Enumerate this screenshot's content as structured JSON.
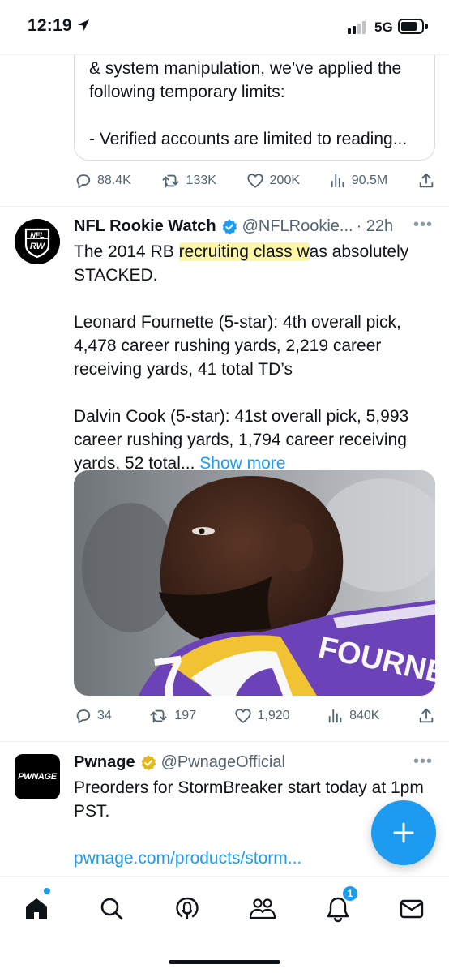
{
  "status_bar": {
    "time": "12:19",
    "network": "5G"
  },
  "quote_card": {
    "lines": [
      "& system manipulation, we’ve applied the",
      "following temporary limits:",
      "- Verified accounts are limited to reading..."
    ]
  },
  "tweet1_actions": {
    "replies": "88.4K",
    "retweets": "133K",
    "likes": "200K",
    "views": "90.5M"
  },
  "tweet2": {
    "name": "NFL Rookie Watch",
    "handle": "@NFLRookie...",
    "time": "· 22h",
    "avatar_text_top": "NFL",
    "avatar_text_bottom": "RW",
    "text_pre": "The 2014 RB ",
    "text_highlight": "recruiting class w",
    "text_post": "as absolutely",
    "text_line2": "STACKED.",
    "para2": "Leonard Fournette (5-star): 4th overall pick, 4,478 career rushing yards, 2,219 career receiving yards, 41 total TD’s",
    "para3": "Dalvin Cook (5-star): 41st overall pick, 5,993 career rushing yards, 1,794 career receiving yards, 52 total...",
    "show_more": "Show more",
    "media_jersey_number": "7",
    "media_jersey_name": "FOURNE",
    "actions": {
      "replies": "34",
      "retweets": "197",
      "likes": "1,920",
      "views": "840K"
    }
  },
  "tweet3": {
    "name": "Pwnage",
    "handle": "@PwnageOfficial",
    "avatar_text": "PWNAGE",
    "text": "Preorders for StormBreaker start today at 1pm PST.",
    "link": "pwnage.com/products/storm..."
  },
  "fab": {
    "icon": "plus-icon"
  },
  "bottom_nav": {
    "items": [
      "home-icon",
      "search-icon",
      "spaces-icon",
      "communities-icon",
      "notifications-icon",
      "messages-icon"
    ],
    "notification_count": "1"
  },
  "colors": {
    "accent": "#1d9bf0",
    "secondary_text": "#536471",
    "verified_gold": "#e2b719",
    "highlight": "#fdf6a8"
  }
}
